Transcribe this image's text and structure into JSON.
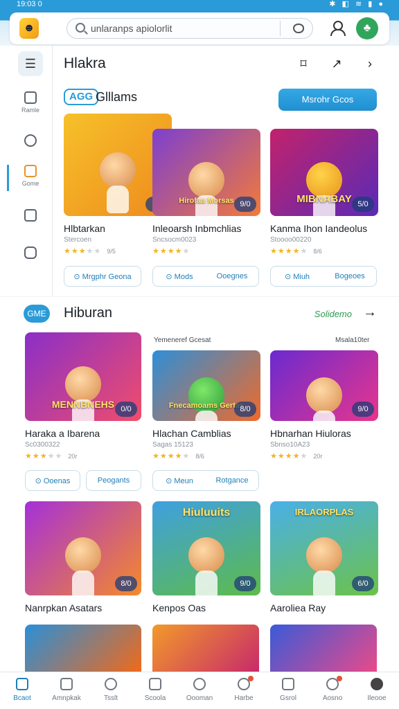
{
  "status_bar": {
    "time": "19:03 0",
    "icons": "✱ ◧ ≋ ▮ ●"
  },
  "header": {
    "logo_icon": "game-logo",
    "search": {
      "value": "unlaranps apiolorlit",
      "icon": "search-icon",
      "mic_icon": "mic-icon"
    },
    "profile_icon": "user-icon",
    "avatar_icon": "avatar-leaf"
  },
  "sidebar": {
    "menu_icon": "☰",
    "items": [
      {
        "label": "Ramle",
        "icon": "card-icon"
      },
      {
        "label": "",
        "icon": "tag-icon"
      },
      {
        "label": "Gome",
        "icon": "folder-icon",
        "active": true
      },
      {
        "label": "",
        "icon": "book-icon"
      },
      {
        "label": "",
        "icon": "puzzle-icon"
      }
    ]
  },
  "section1": {
    "title": "Hlakra",
    "header_icons": [
      "bookmark-icon",
      "share-icon",
      "chevron-right-icon"
    ],
    "badge": "AGG",
    "label": "Glllams",
    "cta_label": "Msrohr Gcos",
    "cards": [
      {
        "name": "Hlbtarkan",
        "sub": "Stercoen",
        "stars": 3,
        "count": "9/5",
        "badge": "10",
        "art_text": "",
        "colors": [
          "#f6c12a",
          "#ee8a1d"
        ]
      },
      {
        "name": "Inleoarsh Inbmchlias",
        "sub": "Sncsocm0023",
        "stars": 4,
        "count": "",
        "badge": "9/0",
        "art_text": "Hirofaa Morsas",
        "colors": [
          "#7d3fd0",
          "#f27a3a"
        ]
      },
      {
        "name": "Kanma Ihon Iandeolus",
        "sub": "Stoooo00220",
        "stars": 4,
        "count": "8/6",
        "badge": "5/0",
        "art_text": "MIBNABAY",
        "colors": [
          "#c2226c",
          "#5a2bb5"
        ]
      }
    ],
    "action_rows": [
      {
        "items": [
          "⊙ Mrgphr Geona"
        ]
      },
      {
        "items": [
          "⊙ Mods",
          "Ooegnes"
        ]
      },
      {
        "items": [
          "⊙ Miuh",
          "Bogeoes"
        ]
      }
    ]
  },
  "section2": {
    "badge": "GME",
    "title": "Hiburan",
    "more_label": "Solidemo",
    "arrow_icon": "arrow-right-icon",
    "captions": [
      "Yemeneref Gcesat",
      "Msala10ter"
    ],
    "cards_row1": [
      {
        "name": "Haraka a Ibarena",
        "sub": "Sc0300322",
        "stars": 3,
        "count": "20r",
        "badge": "0/0",
        "art_text": "MENNBNEHS",
        "colors": [
          "#8a2fc9",
          "#f04d6a"
        ]
      },
      {
        "name": "Hlachan Camblias",
        "sub": "Sagas 15123",
        "stars": 4,
        "count": "8/6",
        "badge": "8/0",
        "art_text": "Fnecamoams Gertas",
        "colors": [
          "#2d8fd8",
          "#ef6a2a"
        ]
      },
      {
        "name": "Hbnarhan Hiuloras",
        "sub": "Sbnso10A23",
        "stars": 4,
        "count": "20r",
        "badge": "9/0",
        "art_text": "",
        "colors": [
          "#6a2ad0",
          "#e8358c"
        ]
      }
    ],
    "actions_row": [
      {
        "items": [
          "⊙ Ooenas"
        ]
      },
      {
        "items": [
          "Peogants"
        ]
      },
      {
        "items": [
          "⊙ Meun",
          "Rotgance"
        ]
      }
    ],
    "cards_row2": [
      {
        "name": "Nanrpkan Asatars",
        "badge": "8/0",
        "colors": [
          "#a530d9",
          "#f58a2a"
        ]
      },
      {
        "name": "Kenpos Oas",
        "badge": "9/0",
        "art_text": "Hiuluuits",
        "colors": [
          "#3fa0e0",
          "#5dbb4a"
        ]
      },
      {
        "name": "Aaroliea Ray",
        "badge": "6/0",
        "art_text": "IRLAORPLAS",
        "colors": [
          "#4ab0e8",
          "#6cc24a"
        ]
      }
    ],
    "cards_row3_colors": [
      [
        "#2a8fd8",
        "#f06a1a"
      ],
      [
        "#f29a2a",
        "#c82a6a"
      ],
      [
        "#3a5ad8",
        "#e84a8a"
      ]
    ]
  },
  "bottom_nav": [
    {
      "label": "Bcaot",
      "icon": "home-icon",
      "active": true
    },
    {
      "label": "Amnpkak",
      "icon": "list-icon"
    },
    {
      "label": "Tsslt",
      "icon": "person-icon"
    },
    {
      "label": "Scoola",
      "icon": "bag-icon"
    },
    {
      "label": "Oooman",
      "icon": "face-icon"
    },
    {
      "label": "Harbe",
      "icon": "bell-icon",
      "dot": true
    },
    {
      "label": "Gsrol",
      "icon": "house-icon"
    },
    {
      "label": "Aosno",
      "icon": "mail-icon",
      "dot": true
    },
    {
      "label": "Ileooe",
      "icon": "profile-icon"
    }
  ]
}
